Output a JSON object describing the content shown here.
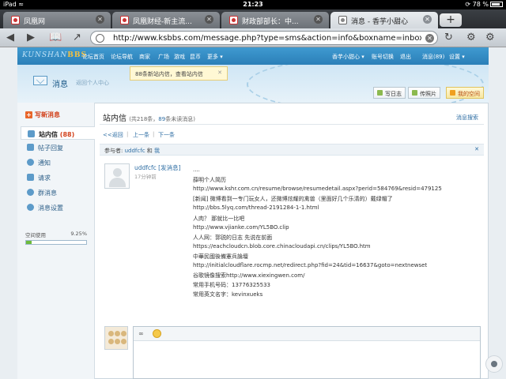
{
  "status_bar": {
    "device": "iPad",
    "wifi": "≈",
    "time": "21:23",
    "battery": "78 %",
    "orientation_lock": "⟳"
  },
  "tabs": [
    {
      "title": "凤凰网"
    },
    {
      "title": "凤凰财经-新主流..."
    },
    {
      "title": "财政部部长：中..."
    },
    {
      "title": "消息 - 香芋小甜心"
    }
  ],
  "toolbar": {
    "back": "◀",
    "forward": "▶",
    "bookmarks": "📖",
    "share": "↗",
    "url": "http://www.ksbbs.com/message.php?type=sms&action=info&boxname=inbox...",
    "clear": "✕",
    "reload": "↻",
    "tools": "⚙",
    "add_tab": "+"
  },
  "site": {
    "logo_text": "KUNSHAN",
    "logo_bbs": "BBS",
    "nav": [
      "论坛首页",
      "论坛导航",
      "商家",
      "广场",
      "游戏",
      "昆币",
      "更多 ▾"
    ],
    "user_nav": [
      "香芋小甜心 ▾",
      "账号切换",
      "退出",
      "消息(89)",
      "设置 ▾"
    ]
  },
  "notice": {
    "text": "88条新站内信，查看站内信",
    "close": "✕"
  },
  "header": {
    "title": "消息",
    "back_home": "返回个人中心",
    "buttons": {
      "diary": "写日志",
      "photo": "传照片",
      "space": "我的空间"
    }
  },
  "sidebar": {
    "compose": "写新消息",
    "items": [
      {
        "label": "站内信",
        "count": "(88)"
      },
      {
        "label": "帖子回复",
        "count": ""
      },
      {
        "label": "通知",
        "count": ""
      },
      {
        "label": "请求",
        "count": ""
      },
      {
        "label": "群消息",
        "count": ""
      },
      {
        "label": "消息设置",
        "count": ""
      }
    ],
    "space_label": "空间使用",
    "space_percent": "9.25%",
    "space_fraction": 0.0925
  },
  "content": {
    "title": "站内信",
    "count_pre": "(共218条，",
    "unread": "89",
    "count_post": "条未读消息)",
    "search": "消息搜索",
    "pager": {
      "back": "<<返回",
      "prev": "上一条",
      "sep": "|",
      "next": "下一条"
    },
    "participants_label": "参与者:",
    "participant_user": "uddfcfc",
    "participant_and": "和",
    "participant_me": "我",
    "participants_close": "✕",
    "message": {
      "sender": "uddfcfc [发消息]",
      "time": "17分钟前",
      "lines": [
        "....",
        "薛明个人简历",
        "http://www.kshr.com.cn/resume/browse/resumedetail.aspx?perid=584769&resid=479125",
        "[新闻] 微博看到一专门玩女人，还微博炫耀的禽兽（里面好几个乐清的）戴绿帽了",
        "http://bbs.5lyq.com/thread-2191284-1-1.html",
        "人肉？ 那就比一比吧",
        "http://www.vjianke.com/YL5BO.clip",
        "人人网：郭锐的日志 先说在前面",
        "https://eachcloudcn.blob.core.chinacloudapi.cn/clips/YL5BO.htm",
        "中華民國後備憲兵論壇",
        "http://initialcloudflare.rocmp.net/redirect.php?fid=24&tid=16637&goto=nextnewset",
        "谷歌镜像搜索http://www.xiexingwen.com/",
        "常用手机号码：13776325533",
        "常用英文名字：kevinxueks"
      ]
    },
    "reply_tool": "∞"
  }
}
